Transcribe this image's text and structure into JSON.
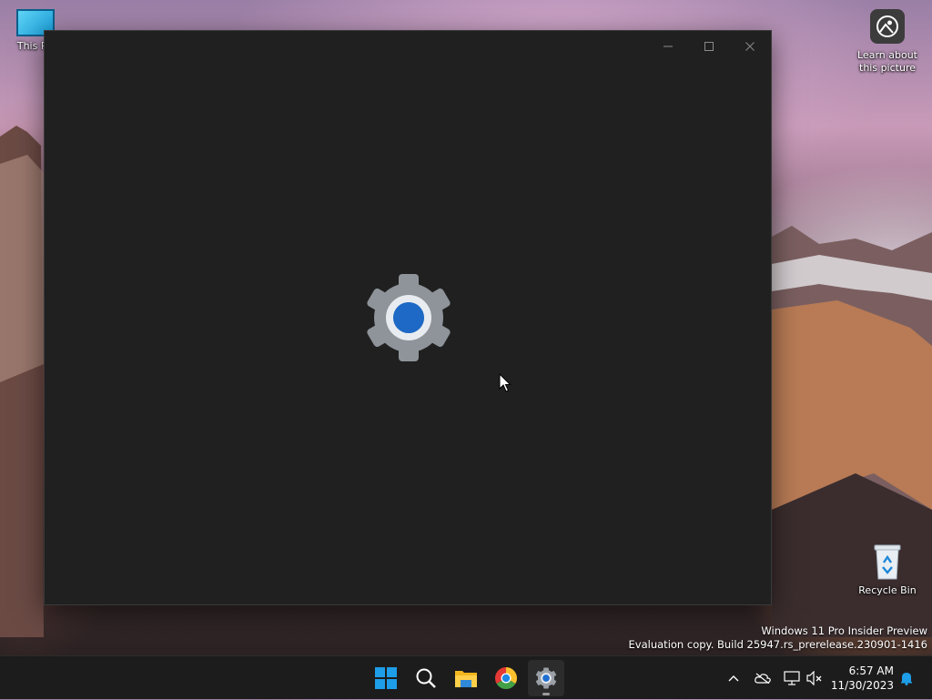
{
  "desktop": {
    "icons": {
      "this_pc": "This PC",
      "learn_picture": "Learn about this picture",
      "recycle_bin": "Recycle Bin"
    },
    "watermark": {
      "line1": "Windows 11 Pro Insider Preview",
      "line2": "Evaluation copy. Build 25947.rs_prerelease.230901-1416"
    }
  },
  "window": {
    "app": "Settings",
    "state": "loading splash",
    "icon": "settings-gear-icon",
    "controls": [
      "minimize-icon",
      "maximize-icon",
      "close-icon"
    ]
  },
  "taskbar": {
    "apps": [
      "windows-start-icon",
      "search-icon",
      "file-explorer-icon",
      "chrome-icon",
      "settings-icon"
    ],
    "active_app": "Settings",
    "clock": {
      "time": "6:57 AM",
      "date": "11/30/2023"
    },
    "tray": [
      "chevron-up-icon",
      "onedrive-icon",
      "network-icon",
      "volume-muted-icon",
      "notification-bell-icon"
    ]
  },
  "colors": {
    "window_bg": "#202020",
    "taskbar_bg": "#1c1c1c",
    "accent": "#1f6fd1",
    "windows_blue": "#1e9de8"
  }
}
